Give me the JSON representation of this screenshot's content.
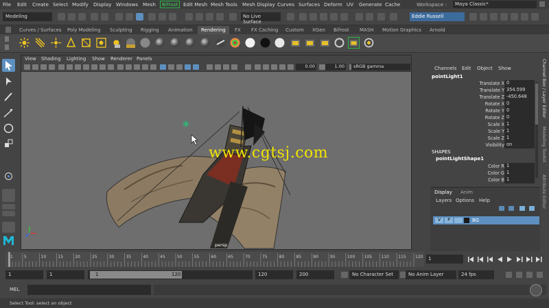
{
  "menubar": {
    "items": [
      "File",
      "Edit",
      "Create",
      "Select",
      "Modify",
      "Display",
      "Windows",
      "Mesh",
      "Bifrost",
      "Edit Mesh",
      "Mesh Tools",
      "Mesh Display",
      "Curves",
      "Surfaces",
      "Deform",
      "UV",
      "Generate",
      "Cache"
    ],
    "workspace_label": "Workspace :",
    "workspace_value": "Maya Classic*"
  },
  "statusline": {
    "mode": "Modeling",
    "live_surface": "No Live Surface",
    "user": "Eddie Russell"
  },
  "shelf": {
    "tabs": [
      "Curves / Surfaces",
      "Poly Modeling",
      "Sculpting",
      "Rigging",
      "Animation",
      "Rendering",
      "FX",
      "FX Caching",
      "Custom",
      "XGen",
      "Bifrost",
      "MASH",
      "Motion Graphics",
      "Arnold"
    ],
    "active_tab": "Rendering"
  },
  "viewport": {
    "menus": [
      "View",
      "Shading",
      "Lighting",
      "Show",
      "Renderer",
      "Panels"
    ],
    "field_a": "0.00",
    "field_b": "1.00",
    "color_space": "sRGB gamma",
    "camera_label": "persp",
    "watermark": "www.cgtsj.com"
  },
  "channelbox": {
    "menus": [
      "Channels",
      "Edit",
      "Object",
      "Show"
    ],
    "node": "pointLight1",
    "attributes": [
      {
        "label": "Translate X",
        "value": "0"
      },
      {
        "label": "Translate Y",
        "value": "354.599"
      },
      {
        "label": "Translate Z",
        "value": "-450.648"
      },
      {
        "label": "Rotate X",
        "value": "0"
      },
      {
        "label": "Rotate Y",
        "value": "0"
      },
      {
        "label": "Rotate Z",
        "value": "0"
      },
      {
        "label": "Scale X",
        "value": "1"
      },
      {
        "label": "Scale Y",
        "value": "1"
      },
      {
        "label": "Scale Z",
        "value": "1"
      },
      {
        "label": "Visibility",
        "value": "on"
      }
    ],
    "shapes_header": "SHAPES",
    "shape_node": "pointLightShape1",
    "shape_attributes": [
      {
        "label": "Color R",
        "value": "1"
      },
      {
        "label": "Color G",
        "value": "1"
      },
      {
        "label": "Color B",
        "value": "1"
      }
    ],
    "side_tabs": [
      "Channel Box / Layer Editor",
      "Modeling Toolkit",
      "Attribute Editor"
    ]
  },
  "layers": {
    "tabs": [
      "Display",
      "Anim"
    ],
    "menus": [
      "Layers",
      "Options",
      "Help"
    ],
    "layer_v": "V",
    "layer_p": "P",
    "layer_name": "BG"
  },
  "timeline": {
    "ticks": [
      "1",
      "5",
      "10",
      "15",
      "20",
      "25",
      "30",
      "35",
      "40",
      "45",
      "50",
      "55",
      "60",
      "65",
      "70",
      "75",
      "80",
      "85",
      "90",
      "95",
      "100",
      "105",
      "110",
      "115",
      "120"
    ],
    "current_frame": "1"
  },
  "range": {
    "start": "1",
    "playback_start": "1",
    "slider_start": "1",
    "slider_end": "120",
    "playback_end": "120",
    "end": "200",
    "character_set": "No Character Set",
    "anim_layer": "No Anim Layer",
    "fps": "24 fps"
  },
  "cmdline": {
    "label": "MEL"
  },
  "helpline": {
    "text": "Select Tool: select an object"
  }
}
